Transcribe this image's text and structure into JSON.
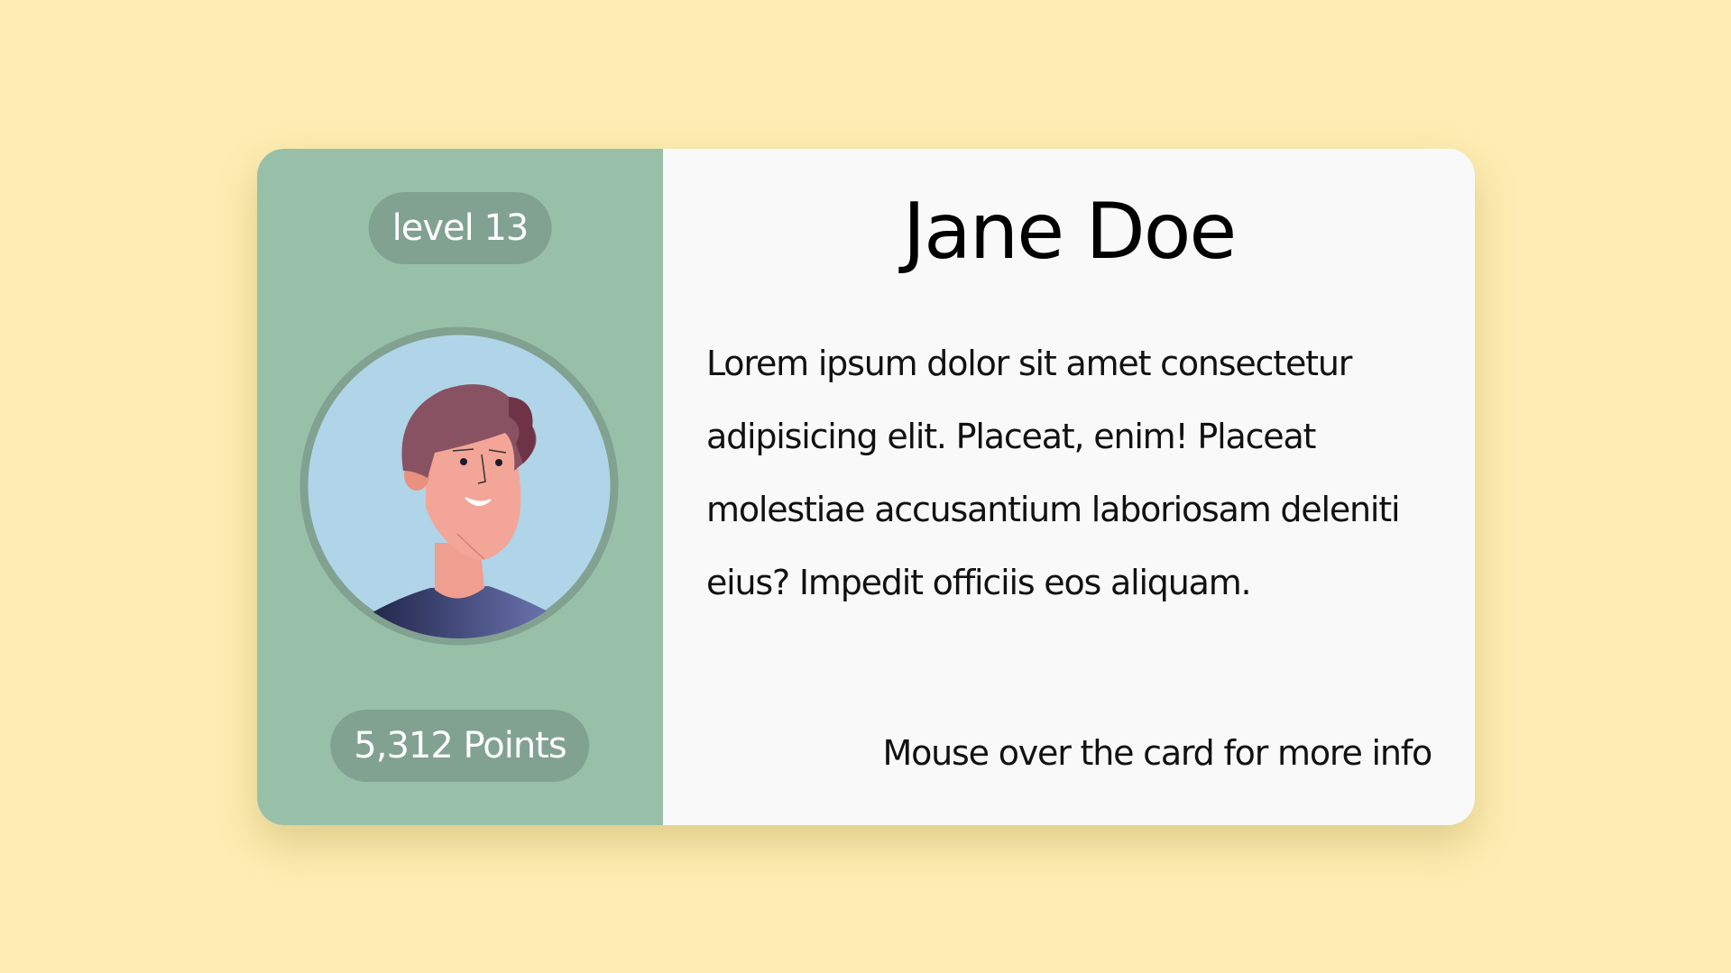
{
  "card": {
    "level_label": "level 13",
    "points_label": "5,312 Points",
    "name": "Jane Doe",
    "bio": "Lorem ipsum dolor sit amet consectetur adipisicing elit. Placeat, enim! Placeat molestiae accusantium laboriosam deleniti eius? Impedit officiis eos aliquam.",
    "hint": "Mouse over the card for more info"
  },
  "colors": {
    "page_background": "#fdedb2",
    "left_panel": "#98c0a9",
    "badge_background": "#81a290",
    "avatar_background": "#b0d4e8",
    "avatar_ring": "#81a290",
    "card_background": "#f9f9f9"
  },
  "icons": {
    "avatar": "person-avatar-illustration"
  }
}
